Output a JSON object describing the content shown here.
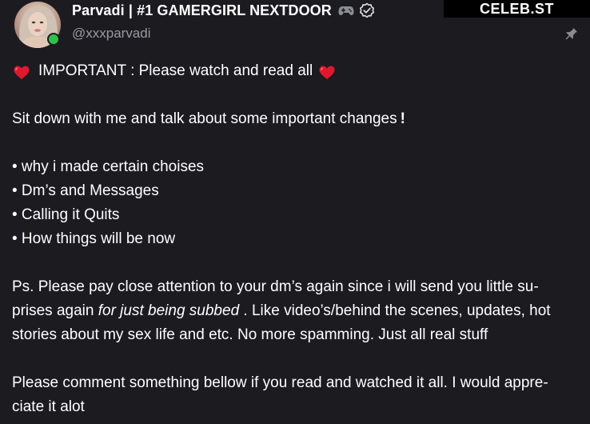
{
  "watermark": "CELEB.ST",
  "author": {
    "display_name": "Parvadi | #1 GAMERGIRL NEXTDOOR",
    "handle": "@xxxparvadi"
  },
  "post": {
    "heading": "IMPORTANT : Please watch and read all",
    "intro": "Sit down with me and talk about some important changes",
    "intro_mark": "!",
    "bullets": [
      "• why i made certain choises",
      "• Dm’s and Messages",
      "• Calling it Quits",
      "• How things will be now"
    ],
    "ps_line1": "Ps. Please pay close attention to your dm’s again since i will send you little su-",
    "ps_line2_a": "prises again ",
    "ps_line2_em": "for just being subbed",
    "ps_line2_b": " . Like video’s/behind the scenes, updates, hot",
    "ps_line3": "stories about my sex life and etc. No more spamming. Just all real stuff",
    "closing_line1": "Please comment something bellow if you read and watched it all. I would appre-",
    "closing_line2": "ciate it alot"
  },
  "icons": {
    "heart": "heart-icon",
    "gamepad": "gamepad-icon",
    "verified": "verified-icon",
    "pin": "pin-icon",
    "online": "online-status-dot"
  },
  "colors": {
    "background": "#1c1b20",
    "heart": "#e0182d",
    "online": "#2fbf4a",
    "handle": "#9a9aa3"
  }
}
